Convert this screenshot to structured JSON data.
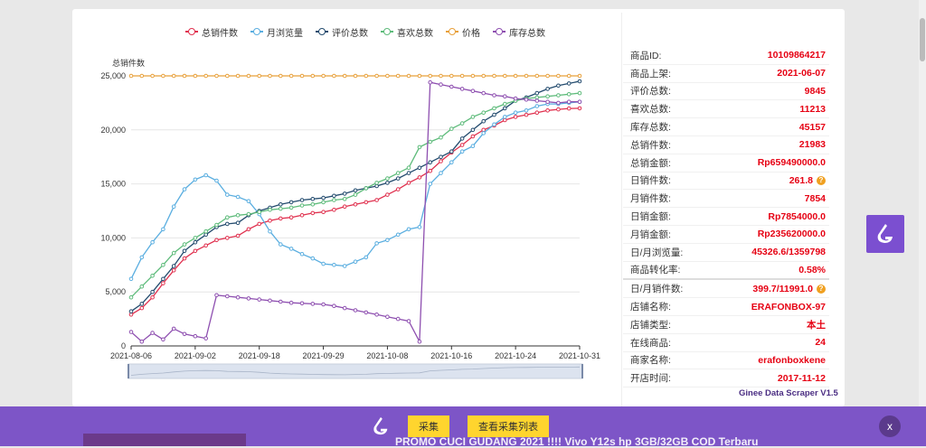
{
  "legend": [
    {
      "label": "总销件数",
      "color": "#e0304e"
    },
    {
      "label": "月浏览量",
      "color": "#5aaee0"
    },
    {
      "label": "评价总数",
      "color": "#234b6e"
    },
    {
      "label": "喜欢总数",
      "color": "#5dbb7a"
    },
    {
      "label": "价格",
      "color": "#e8a03a"
    },
    {
      "label": "库存总数",
      "color": "#8e4fb0"
    }
  ],
  "chart_data": {
    "type": "line",
    "ylabel": "总销件数",
    "ylim": [
      0,
      25000
    ],
    "yticks": [
      "0",
      "5,000",
      "10,000",
      "15,000",
      "20,000",
      "25,000"
    ],
    "xticks": [
      "2021-08-06",
      "2021-09-02",
      "2021-09-18",
      "2021-09-29",
      "2021-10-08",
      "2021-10-16",
      "2021-10-24",
      "2021-10-31"
    ],
    "n_points": 43,
    "series": [
      {
        "name": "总销件数",
        "color": "#e0304e",
        "values": [
          2900,
          3500,
          4500,
          5800,
          7000,
          8100,
          8800,
          9300,
          9800,
          10000,
          10200,
          10800,
          11300,
          11600,
          11800,
          11900,
          12100,
          12300,
          12400,
          12600,
          12900,
          13100,
          13300,
          13500,
          14000,
          14500,
          15100,
          15600,
          16200,
          17100,
          17900,
          18600,
          19400,
          20000,
          20400,
          20900,
          21200,
          21400,
          21600,
          21800,
          21900,
          21983,
          22000
        ]
      },
      {
        "name": "月浏览量",
        "color": "#5aaee0",
        "values": [
          6200,
          8200,
          9600,
          10800,
          12900,
          14500,
          15400,
          15800,
          15300,
          14000,
          13800,
          13400,
          12200,
          10600,
          9400,
          9000,
          8500,
          8100,
          7600,
          7500,
          7400,
          7800,
          8200,
          9500,
          9800,
          10300,
          10800,
          11000,
          15000,
          16000,
          17000,
          18000,
          18500,
          19700,
          20500,
          21200,
          21600,
          21800,
          22200,
          22400,
          22400,
          22500,
          22600
        ]
      },
      {
        "name": "评价总数",
        "color": "#234b6e",
        "values": [
          3200,
          3900,
          5000,
          6200,
          7400,
          8800,
          9600,
          10300,
          11000,
          11300,
          11400,
          12100,
          12500,
          12800,
          13100,
          13300,
          13500,
          13600,
          13700,
          13900,
          14100,
          14400,
          14600,
          14800,
          15100,
          15500,
          16000,
          16500,
          17000,
          17500,
          18000,
          19200,
          20000,
          20800,
          21400,
          22000,
          22700,
          23000,
          23400,
          23800,
          24100,
          24300,
          24500
        ]
      },
      {
        "name": "喜欢总数",
        "color": "#5dbb7a",
        "values": [
          4500,
          5500,
          6500,
          7500,
          8600,
          9400,
          10000,
          10600,
          11200,
          11900,
          12100,
          12200,
          12400,
          12600,
          12700,
          12800,
          13000,
          13100,
          13300,
          13500,
          13600,
          14000,
          14600,
          15100,
          15500,
          16000,
          16500,
          18400,
          18900,
          19300,
          20100,
          20600,
          21200,
          21600,
          22000,
          22400,
          22700,
          22900,
          23000,
          23100,
          23200,
          23300,
          23400
        ]
      },
      {
        "name": "价格",
        "color": "#e8a03a",
        "values": [
          25000,
          25000,
          25000,
          25000,
          25000,
          25000,
          25000,
          25000,
          25000,
          25000,
          25000,
          25000,
          25000,
          25000,
          25000,
          25000,
          25000,
          25000,
          25000,
          25000,
          25000,
          25000,
          25000,
          25000,
          25000,
          25000,
          25000,
          25000,
          25000,
          25000,
          25000,
          25000,
          25000,
          25000,
          25000,
          25000,
          25000,
          25000,
          25000,
          25000,
          25000,
          25000,
          25000
        ]
      },
      {
        "name": "库存总数",
        "color": "#8e4fb0",
        "values": [
          1300,
          400,
          1200,
          600,
          1600,
          1100,
          900,
          700,
          4700,
          4600,
          4500,
          4400,
          4300,
          4200,
          4100,
          4000,
          3950,
          3900,
          3850,
          3700,
          3500,
          3300,
          3100,
          2900,
          2700,
          2500,
          2300,
          400,
          24400,
          24200,
          24000,
          23800,
          23600,
          23400,
          23200,
          23100,
          22900,
          22800,
          22700,
          22600,
          22500,
          22600,
          22600
        ]
      }
    ]
  },
  "info_rows": [
    {
      "label": "商品ID:",
      "value": "10109864217"
    },
    {
      "label": "商品上架:",
      "value": "2021-06-07"
    },
    {
      "label": "评价总数:",
      "value": "9845"
    },
    {
      "label": "喜欢总数:",
      "value": "11213"
    },
    {
      "label": "库存总数:",
      "value": "45157"
    },
    {
      "label": "总销件数:",
      "value": "21983"
    },
    {
      "label": "总销金额:",
      "value": "Rp659490000.0"
    },
    {
      "label": "日销件数:",
      "value": "261.8",
      "help": "?"
    },
    {
      "label": "月销件数:",
      "value": "7854"
    },
    {
      "label": "日销金额:",
      "value": "Rp7854000.0"
    },
    {
      "label": "月销金额:",
      "value": "Rp235620000.0"
    },
    {
      "label": "日/月浏览量:",
      "value": "45326.6/1359798"
    },
    {
      "label": "商品转化率:",
      "value": "0.58%"
    },
    {
      "label": "日/月销件数:",
      "value": "399.7/11991.0",
      "help": "?"
    },
    {
      "label": "店铺名称:",
      "value": "ERAFONBOX-97"
    },
    {
      "label": "店铺类型:",
      "value": "本土"
    },
    {
      "label": "在线商品:",
      "value": "24"
    },
    {
      "label": "商家名称:",
      "value": "erafonboxkene"
    },
    {
      "label": "开店时间:",
      "value": "2017-11-12"
    }
  ],
  "version": "Ginee Data Scraper V1.5",
  "bottom_bar": {
    "collect_label": "采集",
    "view_list_label": "查看采集列表",
    "close_label": "x"
  },
  "peek_text": "PROMO CUCI GUDANG 2021 !!!! Vivo Y12s hp 3GB/32GB COD Terbaru"
}
